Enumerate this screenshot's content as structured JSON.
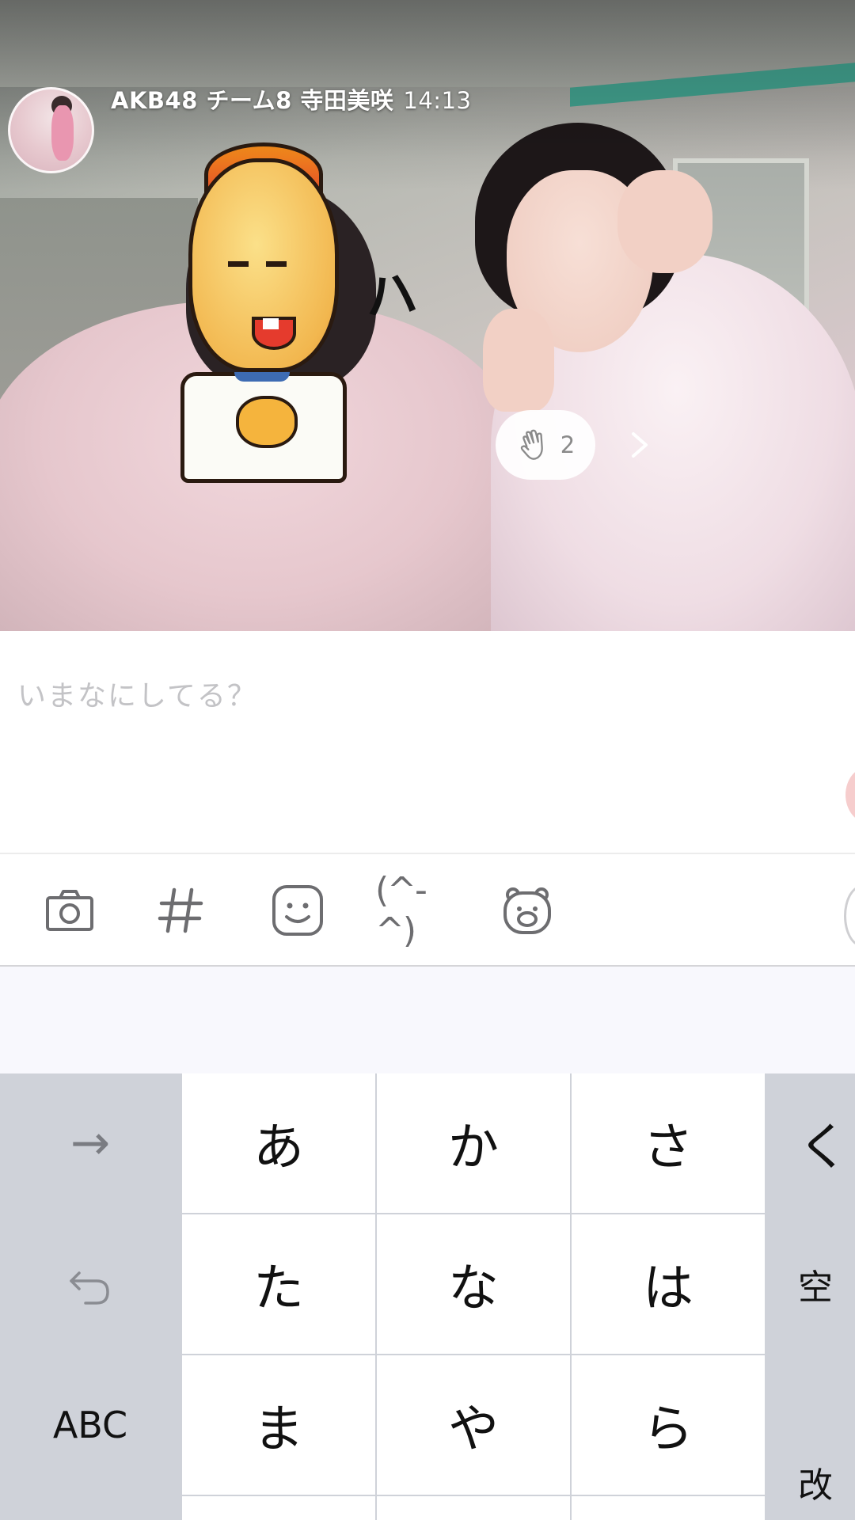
{
  "post": {
    "author": "AKB48 チーム8 寺田美咲",
    "time": "14:13",
    "clap_count": "2"
  },
  "compose": {
    "placeholder": "いまなにしてる？"
  },
  "toolbar": {
    "icons": [
      "camera-icon",
      "hashtag-icon",
      "smiley-icon",
      "emoticon-icon",
      "bear-sticker-icon"
    ],
    "emoticon_text": "(^-^)",
    "hashtag_text": "#"
  },
  "keyboard": {
    "row1": [
      "→",
      "あ",
      "か",
      "さ",
      "く"
    ],
    "row2": [
      "↺",
      "た",
      "な",
      "は",
      "空"
    ],
    "row3": [
      "ABC",
      "ま",
      "や",
      "ら",
      "改"
    ]
  },
  "sticker": {
    "scribble": "ハ"
  }
}
